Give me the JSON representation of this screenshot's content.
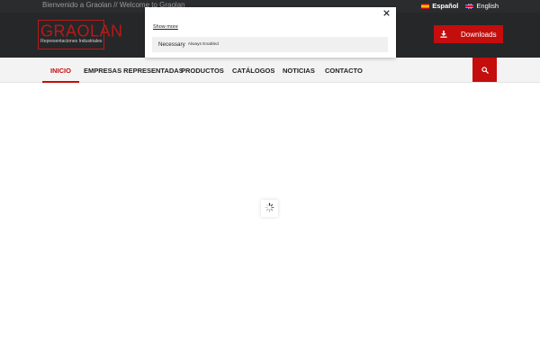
{
  "topbar": {
    "welcome_text": "Bienvenido a Graolan // Welcome to Graolan",
    "languages": [
      {
        "label": "Español",
        "flag": "spain-flag-icon",
        "active": true
      },
      {
        "label": "English",
        "flag": "uk-flag-icon",
        "active": false
      }
    ]
  },
  "header": {
    "logo_main": "GRAOLAN",
    "logo_sub": "Representaciones Industriales",
    "downloads_label": "Downloads",
    "downloads_icon": "download-icon"
  },
  "nav": {
    "items": [
      "INICIO",
      "EMPRESAS REPRESENTADAS",
      "PRODUCTOS",
      "CATÁLOGOS",
      "NOTICIAS",
      "CONTACTO"
    ],
    "active_index": 0,
    "search_icon": "search-icon"
  },
  "cookie_popup": {
    "show_more": "Show more",
    "category_name": "Necessary",
    "category_status": "Always Enabled",
    "close_icon": "close-icon"
  },
  "loader": {
    "icon": "spinner-icon"
  },
  "colors": {
    "accent": "#c40d0d",
    "topbar_bg": "#2b2c2e",
    "header_bg": "#262729",
    "nav_bg": "#f3f3f3"
  }
}
